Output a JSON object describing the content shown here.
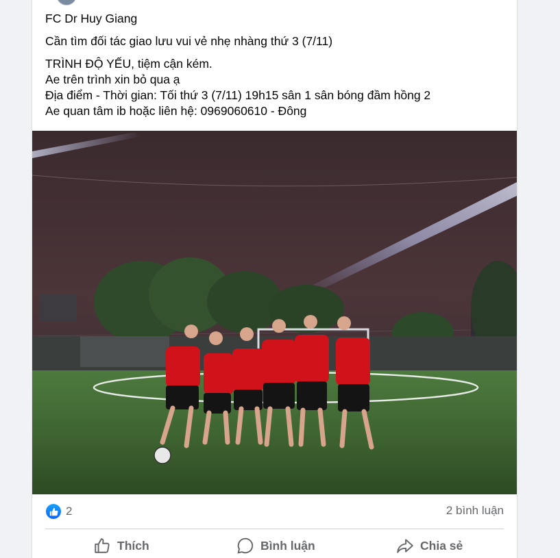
{
  "post": {
    "lines_group1": [
      "FC Dr Huy Giang",
      "Cần tìm đối tác giao lưu vui vẻ nhẹ nhàng thứ 3 (7/11)"
    ],
    "lines_group2": [
      "TRÌNH ĐỘ YẾU, tiệm cận kém.",
      "Ae trên trình xin bỏ qua ạ",
      "Địa điểm - Thời gian: Tối thứ 3 (7/11) 19h15 sân 1 sân bóng đầm hồng 2",
      "Ae quan tâm ib hoặc liên hệ: 0969060610 - Đông"
    ]
  },
  "photo": {
    "icon": "football-team-photo",
    "player_count": 6
  },
  "stats": {
    "reaction_icon": "like-icon",
    "reaction_count": "2",
    "comments": "2 bình luận"
  },
  "actions": {
    "like": "Thích",
    "comment": "Bình luận",
    "share": "Chia sẻ"
  },
  "colors": {
    "accent": "#0866ff",
    "secondary_text": "#65676b",
    "card": "#ffffff",
    "background": "#f0f2f5",
    "jersey": "#d0121b"
  }
}
